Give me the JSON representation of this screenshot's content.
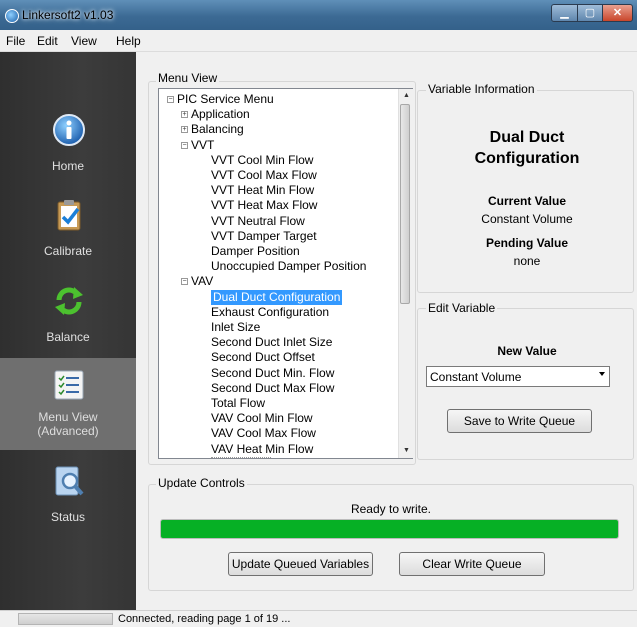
{
  "window": {
    "title": "Linkersoft2 v1.03",
    "min_glyph": "▁",
    "max_glyph": "▢",
    "close_glyph": "✕"
  },
  "menubar": {
    "items": [
      "File",
      "Edit",
      "View",
      "Help"
    ]
  },
  "nav": {
    "items": [
      {
        "label": "Home",
        "icon": "info-icon",
        "active": false
      },
      {
        "label": "Calibrate",
        "icon": "clipboard-check-icon",
        "active": false
      },
      {
        "label": "Balance",
        "icon": "refresh-arrows-icon",
        "active": false
      },
      {
        "label_line1": "Menu View",
        "label_line2": "(Advanced)",
        "icon": "list-icon",
        "active": true
      },
      {
        "label": "Status",
        "icon": "magnifier-icon",
        "active": false
      }
    ]
  },
  "menu_view": {
    "group_label": "Menu View",
    "tree": [
      {
        "label": "PIC Service Menu",
        "level": 0,
        "expander": "−"
      },
      {
        "label": "Application",
        "level": 1,
        "expander": "+"
      },
      {
        "label": "Balancing",
        "level": 1,
        "expander": "+"
      },
      {
        "label": "VVT",
        "level": 1,
        "expander": "−"
      },
      {
        "label": "VVT Cool Min Flow",
        "level": 2
      },
      {
        "label": "VVT Cool Max Flow",
        "level": 2
      },
      {
        "label": "VVT Heat Min Flow",
        "level": 2
      },
      {
        "label": "VVT Heat Max Flow",
        "level": 2
      },
      {
        "label": "VVT Neutral Flow",
        "level": 2
      },
      {
        "label": "VVT Damper Target",
        "level": 2
      },
      {
        "label": "Damper Position",
        "level": 2
      },
      {
        "label": "Unoccupied Damper Position",
        "level": 2
      },
      {
        "label": "VAV",
        "level": 1,
        "expander": "−"
      },
      {
        "label": "Dual Duct Configuration",
        "level": 2,
        "selected": true
      },
      {
        "label": "Exhaust Configuration",
        "level": 2
      },
      {
        "label": "Inlet Size",
        "level": 2
      },
      {
        "label": "Second Duct Inlet Size",
        "level": 2
      },
      {
        "label": "Second Duct Offset",
        "level": 2
      },
      {
        "label": "Second Duct Min. Flow",
        "level": 2
      },
      {
        "label": "Second Duct Max Flow",
        "level": 2
      },
      {
        "label": "Total Flow",
        "level": 2
      },
      {
        "label": "VAV Cool Min Flow",
        "level": 2
      },
      {
        "label": "VAV Cool Max Flow",
        "level": 2
      },
      {
        "label": "VAV Heat Min Flow",
        "level": 2
      }
    ]
  },
  "variable_info": {
    "group_label": "Variable Information",
    "title_line1": "Dual Duct",
    "title_line2": "Configuration",
    "current_label": "Current Value",
    "current_value": "Constant Volume",
    "pending_label": "Pending Value",
    "pending_value": "none"
  },
  "edit_variable": {
    "group_label": "Edit Variable",
    "new_value_label": "New Value",
    "selected_option": "Constant Volume",
    "save_button": "Save to Write Queue"
  },
  "update_controls": {
    "group_label": "Update Controls",
    "status_text": "Ready to write.",
    "progress": 1.0,
    "update_button": "Update Queued Variables",
    "clear_button": "Clear Write Queue"
  },
  "statusbar": {
    "text": "Connected, reading page 1  of 19 ..."
  },
  "colors": {
    "selection": "#3399ff",
    "progress": "#06b025",
    "sidebar": "#353535",
    "sidebar_active": "#6f6f6f"
  }
}
